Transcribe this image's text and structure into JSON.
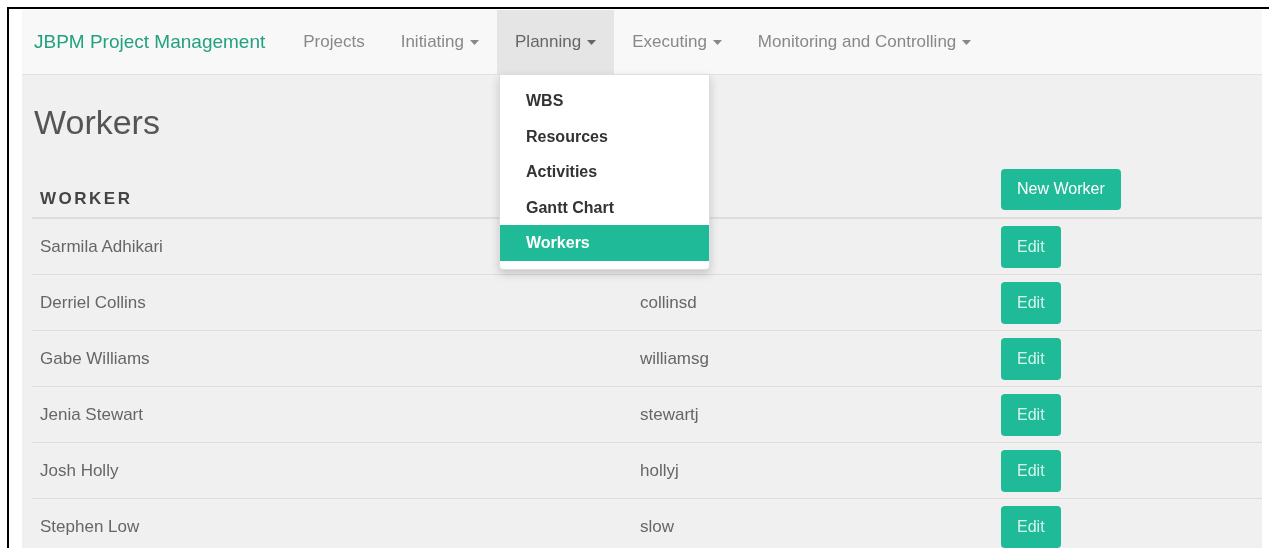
{
  "navbar": {
    "brand": "JBPM Project Management",
    "items": [
      {
        "label": "Projects",
        "dropdown": false,
        "selected": false
      },
      {
        "label": "Initiating",
        "dropdown": true,
        "selected": false
      },
      {
        "label": "Planning",
        "dropdown": true,
        "selected": true,
        "menu": [
          {
            "label": "WBS",
            "selected": false
          },
          {
            "label": "Resources",
            "selected": false
          },
          {
            "label": "Activities",
            "selected": false
          },
          {
            "label": "Gantt Chart",
            "selected": false
          },
          {
            "label": "Workers",
            "selected": true
          }
        ]
      },
      {
        "label": "Executing",
        "dropdown": true,
        "selected": false
      },
      {
        "label": "Monitoring and Controlling",
        "dropdown": true,
        "selected": false
      }
    ]
  },
  "page": {
    "title": "Workers",
    "new_button": "New Worker",
    "table": {
      "columns": [
        "WORKER"
      ],
      "rows": [
        {
          "name": "Sarmila Adhikari",
          "action": "Edit"
        },
        {
          "name": "Derriel Collins",
          "username": "collinsd",
          "action": "Edit"
        },
        {
          "name": "Gabe Williams",
          "username": "williamsg",
          "action": "Edit"
        },
        {
          "name": "Jenia Stewart",
          "username": "stewartj",
          "action": "Edit"
        },
        {
          "name": "Josh Holly",
          "username": "hollyj",
          "action": "Edit"
        },
        {
          "name": "Stephen Low",
          "username": "slow",
          "action": "Edit"
        }
      ]
    }
  }
}
